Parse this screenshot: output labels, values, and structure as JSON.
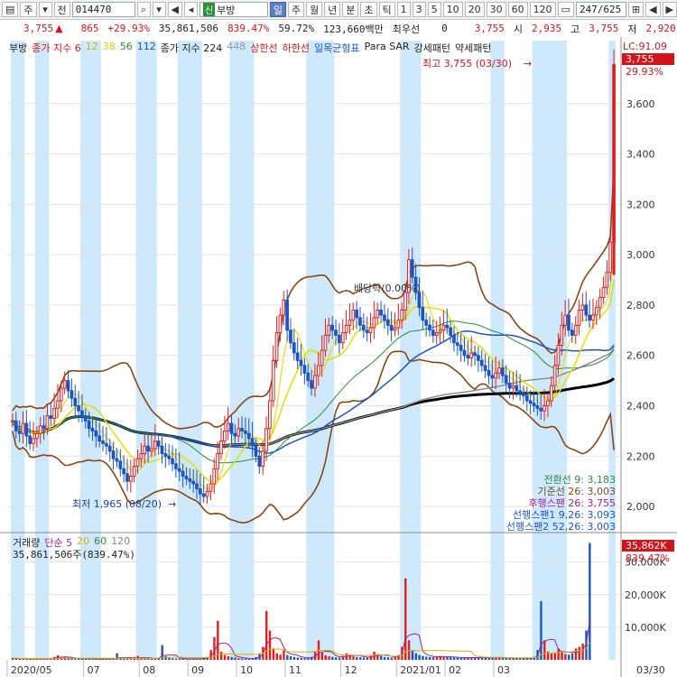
{
  "toolbar": {
    "market": "주",
    "market2": "전",
    "code": "014470",
    "badge": "신",
    "name": "부방",
    "periods": [
      "일",
      "주",
      "월",
      "년",
      "분",
      "초",
      "틱"
    ],
    "intervals": [
      "1",
      "3",
      "5",
      "10",
      "20",
      "30",
      "60",
      "120"
    ],
    "paging": "247/625"
  },
  "quote": {
    "price": "3,755",
    "change": "865",
    "change_pct": "+29.93%",
    "volume": "35,861,506",
    "volume_ratio": "839.47%",
    "turnover_pct": "59.72%",
    "amount": "123,660백만",
    "priority": "최우선",
    "priority_val": "0",
    "bid": "3,755",
    "open_label": "시",
    "open": "2,935",
    "high_label": "고",
    "high": "3,755",
    "low_label": "저",
    "low": "2,920"
  },
  "legend": {
    "name": "부방",
    "ma_label": "종가 지수 6",
    "ma": [
      "12",
      "38",
      "56",
      "112"
    ],
    "ma2": "종가 지수 224",
    "ma3": "448",
    "upper": "상한선",
    "lower": "하한선",
    "ichimoku": "일목균형표",
    "psar": "Para SAR",
    "strong": "강세패턴",
    "weak": "약세패턴",
    "lc": "LC:91.09"
  },
  "annotations": {
    "high": "최고 3,755 (03/30)",
    "low": "최저 1,965 (08/20)",
    "dividend": "배당락(0.00%)",
    "price_tag": "3,755",
    "price_pct": "29.93%"
  },
  "ichimoku_values": [
    {
      "label": "전환선 9: 3,183",
      "color": "#2b8a3e"
    },
    {
      "label": "기준선 26: 3,003",
      "color": "#7a4a1b"
    },
    {
      "label": "후행스팬 26: 3,755",
      "color": "#a020a0"
    },
    {
      "label": "선행스팬1 9,26: 3,093",
      "color": "#1a55c8"
    },
    {
      "label": "선행스팬2 52,26: 3,003",
      "color": "#1a55c8"
    }
  ],
  "volume_legend": {
    "title": "거래량",
    "ma": "단순 5",
    "ma_periods": [
      "20",
      "60",
      "120"
    ],
    "value": "35,861,506주(839.47%)",
    "tag": "35,862K",
    "tag_pct": "839.47%"
  },
  "chart_data": {
    "type": "candlestick",
    "price_axis": {
      "ticks": [
        2000,
        2200,
        2400,
        2600,
        2800,
        3000,
        3200,
        3400,
        3600
      ],
      "labels": [
        "2,000",
        "2,200",
        "2,400",
        "2,600",
        "2,800",
        "3,000",
        "3,200",
        "3,400",
        "3,600"
      ],
      "range": [
        1900,
        3800
      ]
    },
    "volume_axis": {
      "ticks": [
        10000,
        20000,
        30000
      ],
      "labels": [
        "10,000K",
        "20,000K",
        "30,000K"
      ],
      "range": [
        0,
        36000
      ]
    },
    "x_labels": [
      "2020/05",
      "07",
      "08",
      "09",
      "10",
      "11",
      "12",
      "2021/01",
      "02",
      "03",
      "03/30"
    ],
    "close": [
      2340,
      2300,
      2290,
      2330,
      2280,
      2250,
      2270,
      2290,
      2320,
      2310,
      2360,
      2350,
      2390,
      2420,
      2470,
      2500,
      2460,
      2430,
      2400,
      2380,
      2360,
      2340,
      2310,
      2300,
      2280,
      2260,
      2250,
      2240,
      2220,
      2190,
      2180,
      2150,
      2130,
      2100,
      2120,
      2160,
      2190,
      2210,
      2240,
      2220,
      2230,
      2260,
      2240,
      2210,
      2200,
      2190,
      2170,
      2150,
      2140,
      2120,
      2110,
      2100,
      2090,
      2070,
      2050,
      2040,
      2060,
      2090,
      2150,
      2210,
      2260,
      2300,
      2330,
      2290,
      2280,
      2310,
      2300,
      2290,
      2270,
      2240,
      2200,
      2160,
      2220,
      2310,
      2420,
      2580,
      2690,
      2760,
      2820,
      2700,
      2650,
      2610,
      2580,
      2560,
      2530,
      2500,
      2470,
      2520,
      2560,
      2620,
      2680,
      2720,
      2700,
      2680,
      2650,
      2690,
      2720,
      2740,
      2780,
      2750,
      2720,
      2700,
      2690,
      2710,
      2750,
      2780,
      2760,
      2740,
      2720,
      2700,
      2710,
      2740,
      2780,
      2850,
      2980,
      2910,
      2850,
      2790,
      2740,
      2720,
      2700,
      2680,
      2690,
      2700,
      2720,
      2710,
      2680,
      2650,
      2640,
      2620,
      2600,
      2590,
      2610,
      2600,
      2580,
      2560,
      2540,
      2520,
      2510,
      2530,
      2550,
      2520,
      2490,
      2470,
      2480,
      2460,
      2450,
      2440,
      2420,
      2410,
      2400,
      2390,
      2380,
      2400,
      2420,
      2480,
      2560,
      2640,
      2720,
      2760,
      2700,
      2680,
      2720,
      2780,
      2800,
      2760,
      2740,
      2760,
      2790,
      2830,
      2870,
      2930,
      3050,
      3755
    ],
    "volume_k": [
      600,
      400,
      300,
      350,
      500,
      280,
      320,
      250,
      400,
      380,
      420,
      600,
      900,
      1400,
      800,
      700,
      500,
      450,
      400,
      380,
      350,
      300,
      280,
      260,
      240,
      300,
      320,
      280,
      260,
      400,
      2000,
      500,
      350,
      300,
      280,
      900,
      1200,
      600,
      400,
      350,
      300,
      280,
      700,
      4500,
      1100,
      700,
      500,
      400,
      350,
      300,
      280,
      260,
      300,
      320,
      400,
      700,
      900,
      3000,
      7000,
      12000,
      2500,
      1500,
      1100,
      900,
      700,
      500,
      400,
      350,
      300,
      500,
      900,
      2000,
      4000,
      15000,
      9000,
      3500,
      2000,
      1600,
      3000,
      1500,
      1100,
      900,
      700,
      600,
      500,
      450,
      900,
      2500,
      6000,
      2200,
      1400,
      1100,
      900,
      800,
      700,
      1200,
      2000,
      1500,
      1100,
      900,
      800,
      700,
      650,
      1200,
      2500,
      1800,
      1200,
      900,
      800,
      700,
      900,
      1500,
      4000,
      25000,
      6000,
      3000,
      2000,
      1500,
      1200,
      1000,
      900,
      800,
      850,
      1200,
      1000,
      900,
      800,
      700,
      650,
      600,
      700,
      800,
      700,
      650,
      600,
      550,
      600,
      700,
      800,
      700,
      650,
      600,
      550,
      600,
      550,
      500,
      480,
      450,
      500,
      600,
      900,
      3000,
      18000,
      6000,
      2500,
      2000,
      2200,
      3500,
      2500,
      1800,
      1600,
      2000,
      3500,
      4000,
      5000,
      9000,
      35862
    ]
  }
}
